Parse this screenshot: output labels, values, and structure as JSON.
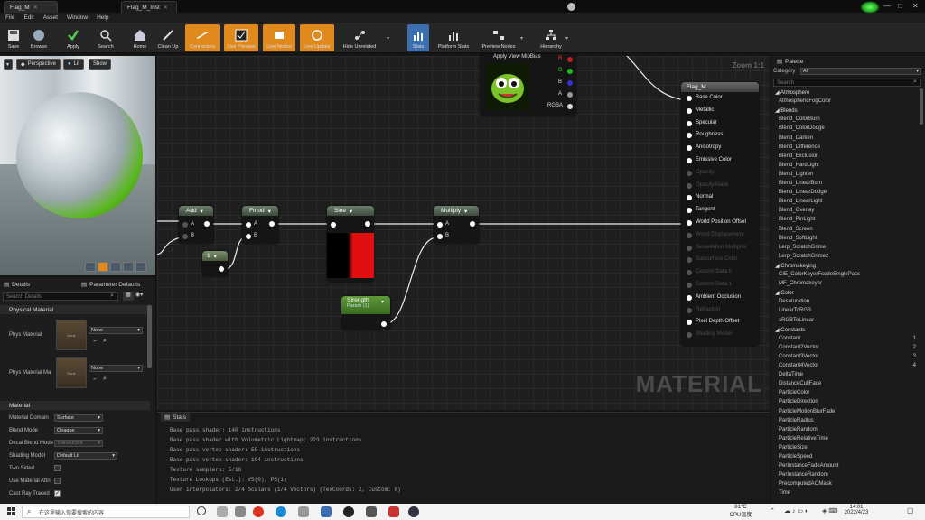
{
  "window": {
    "tabs": [
      {
        "label": "Flag_M"
      },
      {
        "label": "Flag_M_Inst"
      }
    ]
  },
  "menu": [
    "File",
    "Edit",
    "Asset",
    "Window",
    "Help"
  ],
  "toolbar": [
    {
      "label": "Save"
    },
    {
      "label": "Browse"
    },
    {
      "label": "Apply"
    },
    {
      "label": "Search"
    },
    {
      "label": "Home"
    },
    {
      "label": "Clean Up"
    },
    {
      "label": "Connectors"
    },
    {
      "label": "Live Preview"
    },
    {
      "label": "Live Nodes"
    },
    {
      "label": "Live Update"
    },
    {
      "label": "Hide Unrelated"
    },
    {
      "label": "Stats"
    },
    {
      "label": "Platform Stats"
    },
    {
      "label": "Preview Nodes"
    },
    {
      "label": "Hierarchy"
    }
  ],
  "viewport": {
    "perspective": "Perspective",
    "lit": "Lit",
    "show": "Show"
  },
  "details": {
    "tab_details": "Details",
    "tab_params": "Parameter Defaults",
    "search_placeholder": "Search Details",
    "physical_material_section": "Physical Material",
    "phys_material_label": "Phys Material",
    "phys_material_value": "None",
    "phys_material_mask_label": "Phys Material Ma",
    "phys_material_mask_value": "None",
    "thumb_label": "None",
    "material_section": "Material",
    "rows": [
      {
        "label": "Material Domain",
        "value": "Surface"
      },
      {
        "label": "Blend Mode",
        "value": "Opaque"
      },
      {
        "label": "Decal Blend Mode",
        "value": "Translucent"
      },
      {
        "label": "Shading Model",
        "value": "Default Lit"
      },
      {
        "label": "Two Sided",
        "value": ""
      },
      {
        "label": "Use Material Attri",
        "value": ""
      },
      {
        "label": "Cast Ray Traced",
        "value": ""
      }
    ]
  },
  "graph": {
    "zoom": "Zoom 1:1",
    "watermark": "MATERIAL",
    "texture_node": {
      "title": "Apply View MipBias",
      "pins": [
        "R",
        "G",
        "B",
        "A",
        "RGBA"
      ]
    },
    "nodes": {
      "add": "Add",
      "fmod": "Fmod",
      "sine": "Sine",
      "multiply": "Multiply",
      "const": "1",
      "strength": "Strength",
      "strength_sub": "Param (1)"
    },
    "result": {
      "title": "Flag_M",
      "pins": [
        {
          "label": "Base Color",
          "active": true
        },
        {
          "label": "Metallic",
          "active": true
        },
        {
          "label": "Specular",
          "active": true
        },
        {
          "label": "Roughness",
          "active": true
        },
        {
          "label": "Anisotropy",
          "active": true
        },
        {
          "label": "Emissive Color",
          "active": true
        },
        {
          "label": "Opacity",
          "active": false
        },
        {
          "label": "Opacity Mask",
          "active": false
        },
        {
          "label": "Normal",
          "active": true
        },
        {
          "label": "Tangent",
          "active": true
        },
        {
          "label": "World Position Offset",
          "active": true
        },
        {
          "label": "World Displacement",
          "active": false
        },
        {
          "label": "Tessellation Multiplier",
          "active": false
        },
        {
          "label": "Subsurface Color",
          "active": false
        },
        {
          "label": "Custom Data 0",
          "active": false
        },
        {
          "label": "Custom Data 1",
          "active": false
        },
        {
          "label": "Ambient Occlusion",
          "active": true
        },
        {
          "label": "Refraction",
          "active": false
        },
        {
          "label": "Pixel Depth Offset",
          "active": true
        },
        {
          "label": "Shading Model",
          "active": false
        }
      ]
    }
  },
  "stats": {
    "tab": "Stats",
    "lines": [
      "Base pass shader: 140 instructions",
      "Base pass shader with Volumetric Lightmap: 223 instructions",
      "Base pass vertex shader: 55 instructions",
      "Base pass vertex shader: 194 instructions",
      "Texture samplers: 5/16",
      "Texture Lookups (Est.): VS(0), PS(1)",
      "User interpolators: 2/4 Scalars (1/4 Vectors) (TexCoords: 2, Custom: 0)"
    ]
  },
  "palette": {
    "tab": "Palette",
    "category_label": "Category",
    "category_value": "All",
    "search_placeholder": "Search",
    "entries": [
      {
        "text": "Atmosphere",
        "cat": true
      },
      {
        "text": "AtmosphericFogColor"
      },
      {
        "text": "Blends",
        "cat": true
      },
      {
        "text": "Blend_ColorBurn"
      },
      {
        "text": "Blend_ColorDodge"
      },
      {
        "text": "Blend_Darken"
      },
      {
        "text": "Blend_Difference"
      },
      {
        "text": "Blend_Exclusion"
      },
      {
        "text": "Blend_HardLight"
      },
      {
        "text": "Blend_Lighten"
      },
      {
        "text": "Blend_LinearBurn"
      },
      {
        "text": "Blend_LinearDodge"
      },
      {
        "text": "Blend_LinearLight"
      },
      {
        "text": "Blend_Overlay"
      },
      {
        "text": "Blend_PinLight"
      },
      {
        "text": "Blend_Screen"
      },
      {
        "text": "Blend_SoftLight"
      },
      {
        "text": "Lerp_ScratchGrime"
      },
      {
        "text": "Lerp_ScratchGrime2"
      },
      {
        "text": "Chromakeying",
        "cat": true
      },
      {
        "text": "CIE_ColorKeyerFcodeSinglePass"
      },
      {
        "text": "MF_Chromakeyer"
      },
      {
        "text": "Color",
        "cat": true
      },
      {
        "text": "Desaturation"
      },
      {
        "text": "LinearToRGB"
      },
      {
        "text": "sRGBToLinear"
      },
      {
        "text": "Constants",
        "cat": true
      },
      {
        "text": "Constant",
        "num": "1"
      },
      {
        "text": "Constant2Vector",
        "num": "2"
      },
      {
        "text": "Constant3Vector",
        "num": "3"
      },
      {
        "text": "Constant4Vector",
        "num": "4"
      },
      {
        "text": "DeltaTime"
      },
      {
        "text": "DistanceCullFade"
      },
      {
        "text": "ParticleColor"
      },
      {
        "text": "ParticleDirection"
      },
      {
        "text": "ParticleMotionBlurFade"
      },
      {
        "text": "ParticleRadius"
      },
      {
        "text": "ParticleRandom"
      },
      {
        "text": "ParticleRelativeTime"
      },
      {
        "text": "ParticleSize"
      },
      {
        "text": "ParticleSpeed"
      },
      {
        "text": "PerInstanceFadeAmount"
      },
      {
        "text": "PerInstanceRandom"
      },
      {
        "text": "PrecomputedAOMask"
      },
      {
        "text": "Time"
      }
    ]
  },
  "taskbar": {
    "search_placeholder": "在这里输入你要搜索的内容",
    "temp": "81°C",
    "temp_label": "CPU温度",
    "time": "14:01",
    "date": "2022/4/23"
  },
  "colors": {
    "accent": "#e08a1e",
    "node_header": "#4d5e4d",
    "sine_red": "#e01010"
  }
}
